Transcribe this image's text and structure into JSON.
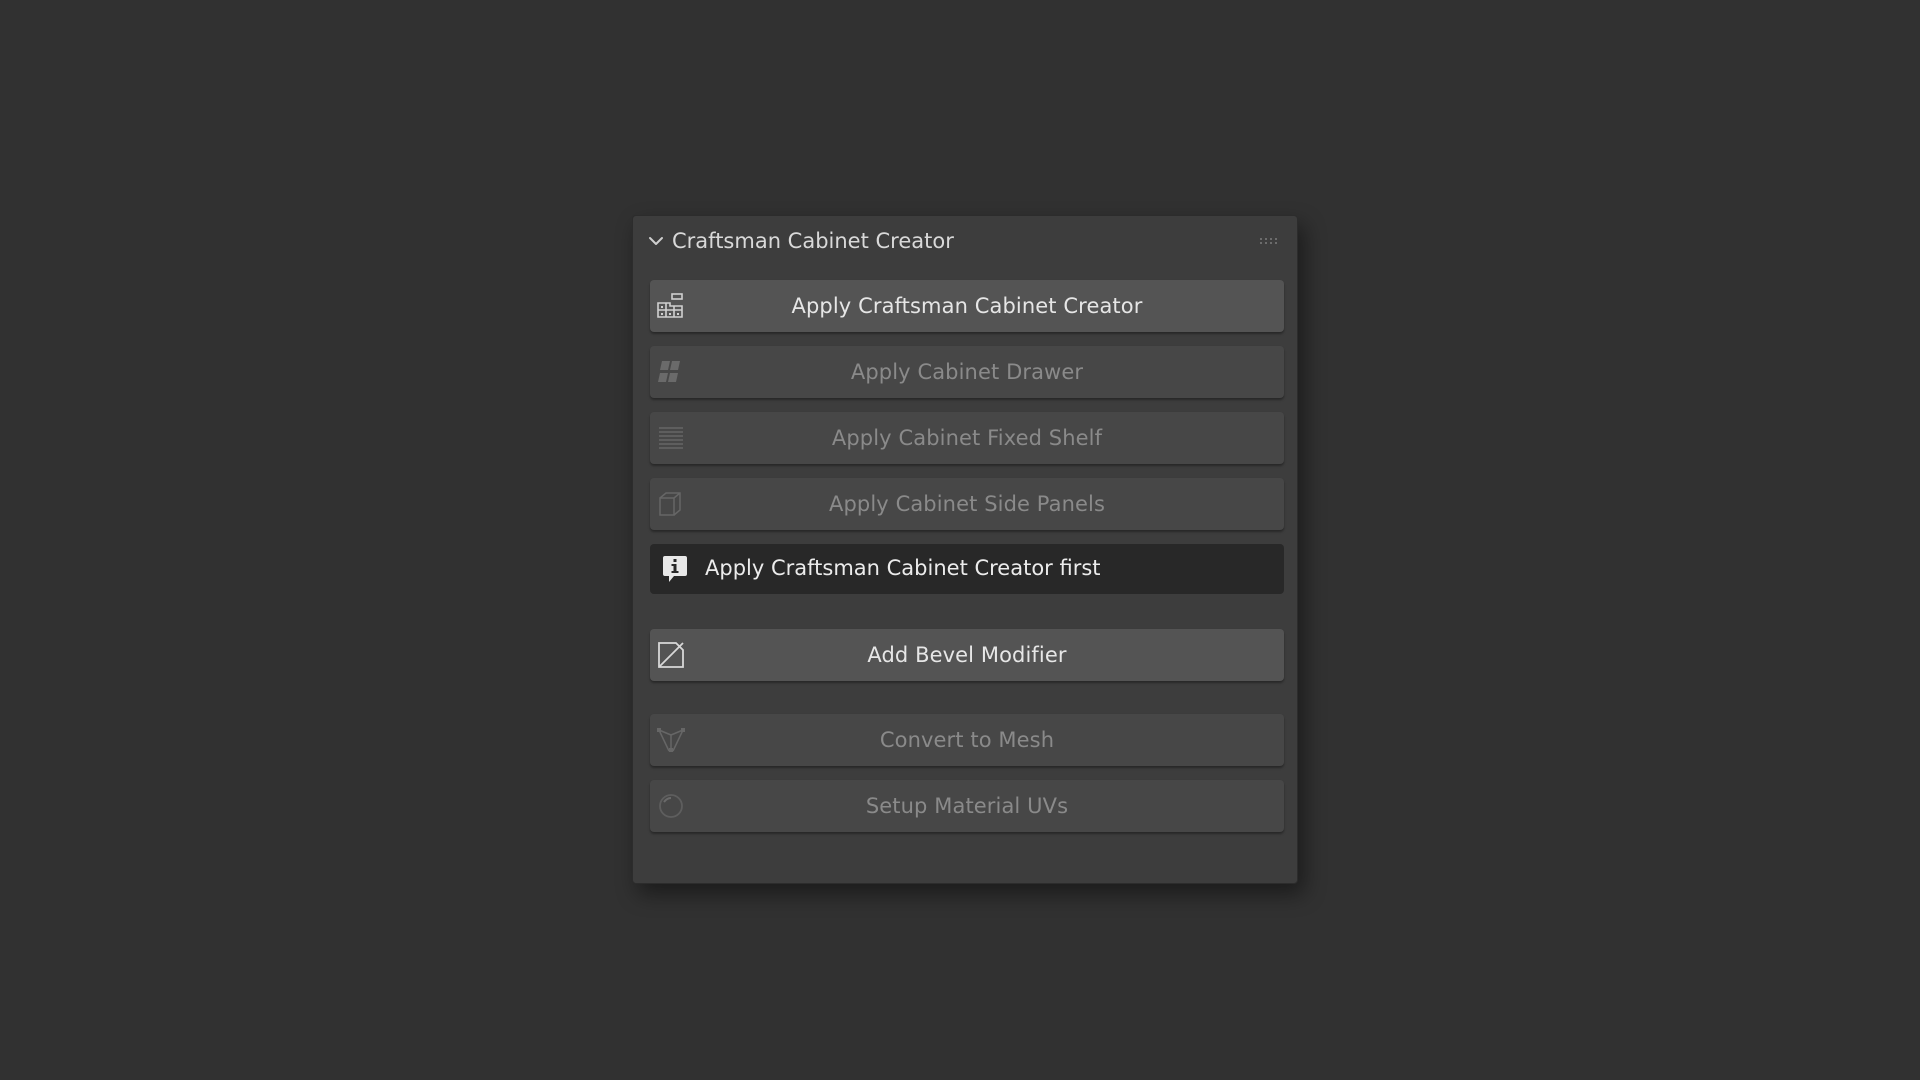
{
  "panel": {
    "title": "Craftsman Cabinet Creator",
    "collapse_icon": "chevron-down-icon",
    "drag_icon": "grip-dots-icon"
  },
  "buttons": [
    {
      "label": "Apply Craftsman Cabinet Creator",
      "icon": "cabinet-icon",
      "enabled": true
    },
    {
      "label": "Apply Cabinet Drawer",
      "icon": "drawer-icon",
      "enabled": false
    },
    {
      "label": "Apply Cabinet Fixed Shelf",
      "icon": "shelf-icon",
      "enabled": false
    },
    {
      "label": "Apply Cabinet Side Panels",
      "icon": "side-panels-icon",
      "enabled": false
    }
  ],
  "info": {
    "message": "Apply Craftsman Cabinet Creator first",
    "icon": "info-icon"
  },
  "bevel_button": {
    "label": "Add Bevel Modifier",
    "icon": "bevel-icon",
    "enabled": true
  },
  "mesh_buttons": [
    {
      "label": "Convert to Mesh",
      "icon": "mesh-icon",
      "enabled": false
    },
    {
      "label": "Setup Material UVs",
      "icon": "material-sphere-icon",
      "enabled": false
    }
  ],
  "colors": {
    "background": "#313131",
    "panel": "#3d3d3d",
    "button": "#545454",
    "button_disabled": "#474747",
    "info_box": "#282828",
    "text": "#e6e6e6",
    "text_disabled": "#8a8a8a"
  }
}
